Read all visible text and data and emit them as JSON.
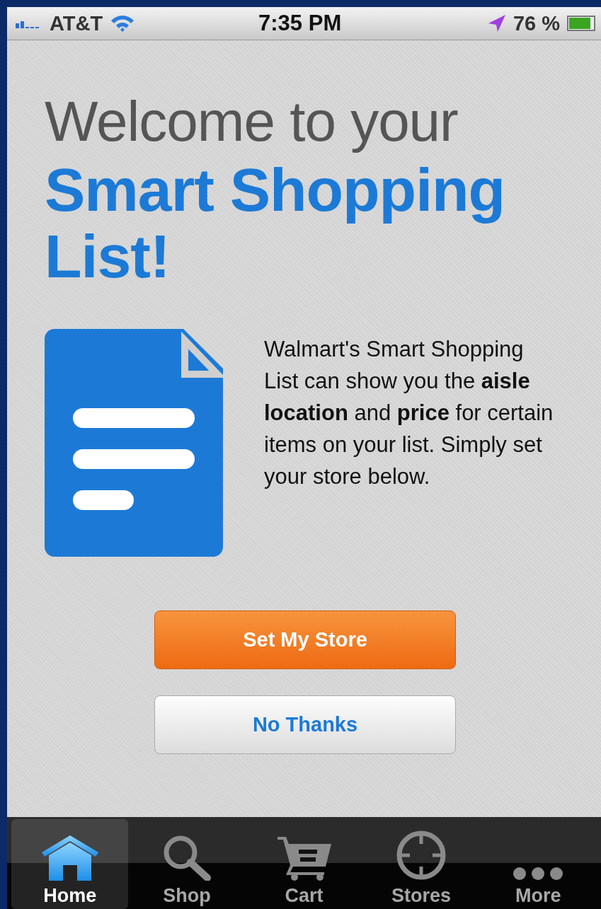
{
  "status_bar": {
    "carrier": "AT&T",
    "time": "7:35 PM",
    "battery": "76 %"
  },
  "heading": {
    "line_1": "Welcome to your",
    "line_2": "Smart Shopping List!"
  },
  "description": "Walmart's Smart Shopping List can show you the **aisle location** and **price** for certain items on your list. Simply set your store below.",
  "buttons": [
    {
      "label": "Set My Store",
      "kind": "primary"
    },
    {
      "label": "No Thanks",
      "kind": "secondary"
    }
  ],
  "tabs": [
    {
      "label": "Home",
      "kind": "home",
      "selected": true
    },
    {
      "label": "Shop",
      "kind": "search",
      "selected": false
    },
    {
      "label": "Cart",
      "kind": "cart",
      "selected": false
    },
    {
      "label": "Stores",
      "kind": "crosshair",
      "selected": false
    },
    {
      "label": "More",
      "kind": "more",
      "selected": false
    }
  ]
}
